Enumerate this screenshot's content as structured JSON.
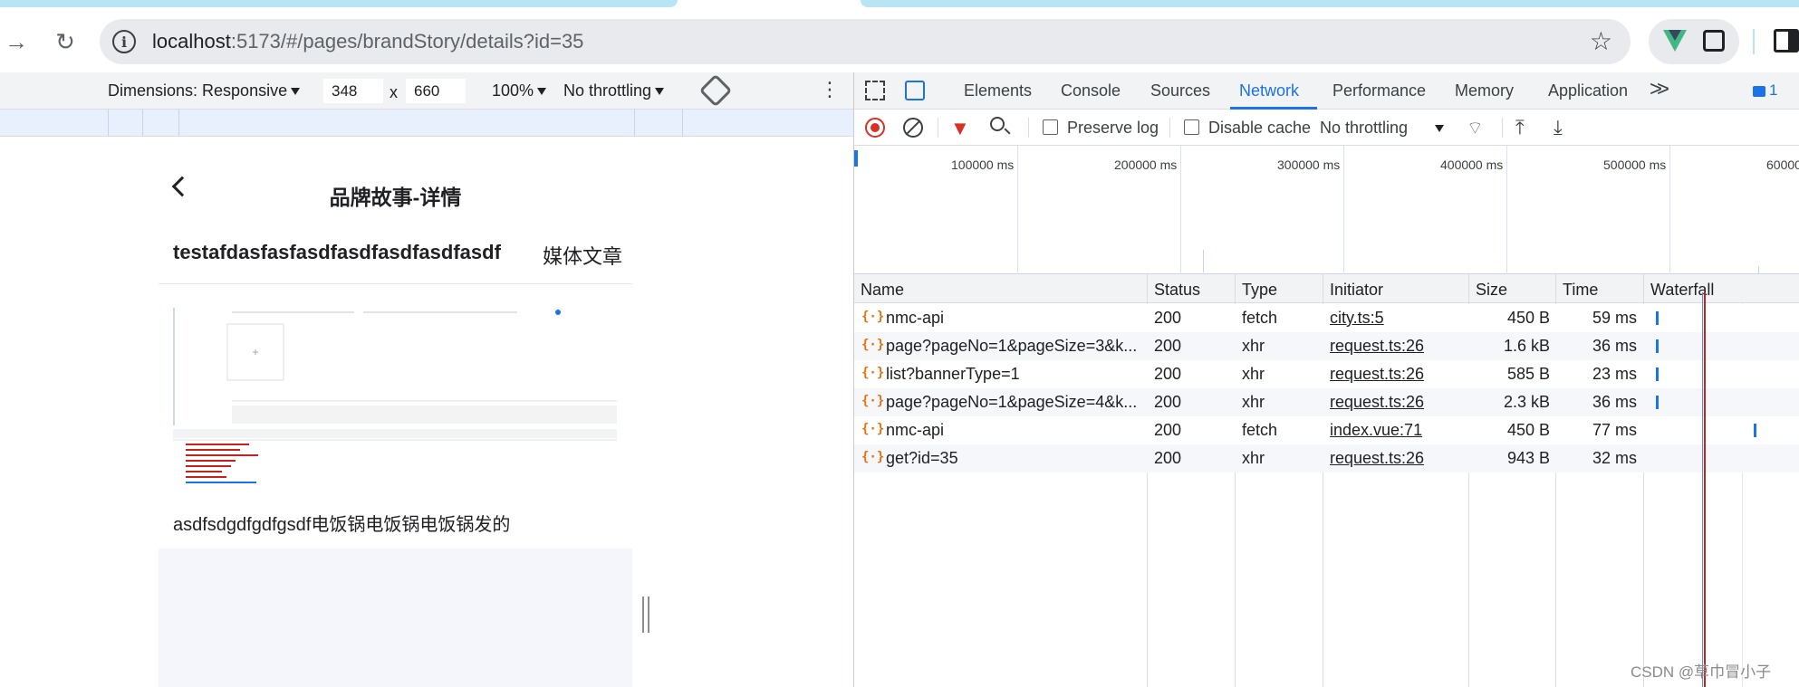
{
  "browser": {
    "url_host": "localhost",
    "url_rest": ":5173/#/pages/brandStory/details?id=35"
  },
  "device_toolbar": {
    "dimensions_label": "Dimensions: Responsive",
    "width": "348",
    "times": "x",
    "height": "660",
    "zoom": "100%",
    "throttling": "No throttling"
  },
  "phone": {
    "nav_title": "品牌故事-详情",
    "article_title": "testafdasfasfasdfasdfasdfasdfasdf",
    "article_category": "媒体文章",
    "article_body": "asdfsdgdfgdfgsdf电饭锅电饭锅电饭锅发的"
  },
  "devtools": {
    "tabs": [
      "Elements",
      "Console",
      "Sources",
      "Network",
      "Performance",
      "Memory",
      "Application"
    ],
    "active_tab": "Network",
    "message_count": "1",
    "toolbar": {
      "preserve_log": "Preserve log",
      "disable_cache": "Disable cache",
      "throttling": "No throttling"
    },
    "overview_ticks": [
      "100000 ms",
      "200000 ms",
      "300000 ms",
      "400000 ms",
      "500000 ms",
      "60000"
    ],
    "columns": [
      "Name",
      "Status",
      "Type",
      "Initiator",
      "Size",
      "Time",
      "Waterfall"
    ],
    "requests": [
      {
        "name": "nmc-api",
        "status": "200",
        "type": "fetch",
        "initiator": "city.ts:5",
        "size": "450 B",
        "time": "59 ms"
      },
      {
        "name": "page?pageNo=1&pageSize=3&k...",
        "status": "200",
        "type": "xhr",
        "initiator": "request.ts:26",
        "size": "1.6 kB",
        "time": "36 ms"
      },
      {
        "name": "list?bannerType=1",
        "status": "200",
        "type": "xhr",
        "initiator": "request.ts:26",
        "size": "585 B",
        "time": "23 ms"
      },
      {
        "name": "page?pageNo=1&pageSize=4&k...",
        "status": "200",
        "type": "xhr",
        "initiator": "request.ts:26",
        "size": "2.3 kB",
        "time": "36 ms"
      },
      {
        "name": "nmc-api",
        "status": "200",
        "type": "fetch",
        "initiator": "index.vue:71",
        "size": "450 B",
        "time": "77 ms"
      },
      {
        "name": "get?id=35",
        "status": "200",
        "type": "xhr",
        "initiator": "request.ts:26",
        "size": "943 B",
        "time": "32 ms"
      }
    ]
  },
  "watermark": "CSDN @草巾冒小子"
}
